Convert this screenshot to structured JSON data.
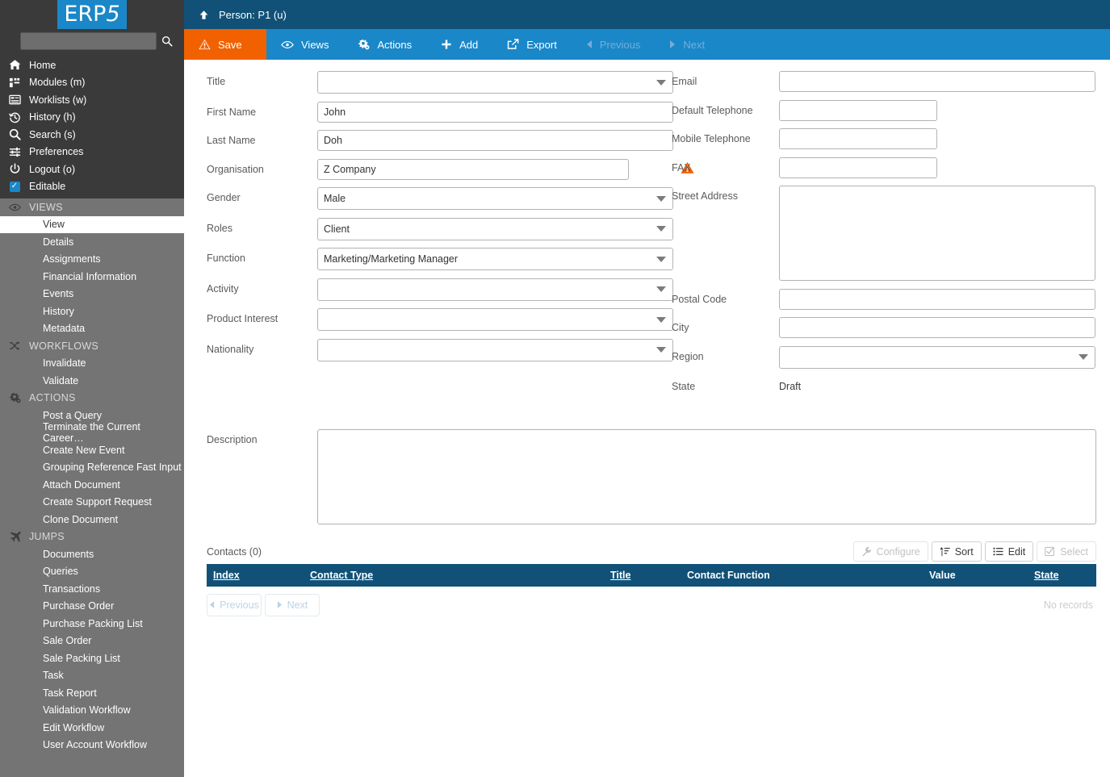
{
  "brand": {
    "name": "ERP5",
    "name_main": "ERP",
    "name_accent": "5"
  },
  "sidebar": {
    "search": {
      "value": "",
      "placeholder": ""
    },
    "nav": [
      {
        "label": "Home",
        "icon": "home-icon"
      },
      {
        "label": "Modules (m)",
        "icon": "modules-icon"
      },
      {
        "label": "Worklists (w)",
        "icon": "worklists-icon"
      },
      {
        "label": "History (h)",
        "icon": "history-icon"
      },
      {
        "label": "Search (s)",
        "icon": "search-icon"
      },
      {
        "label": "Preferences",
        "icon": "sliders-icon"
      },
      {
        "label": "Logout (o)",
        "icon": "power-icon"
      },
      {
        "label": "Editable",
        "icon": "checkbox-icon"
      }
    ],
    "groups": [
      {
        "title": "VIEWS",
        "icon": "eye-icon",
        "items": [
          {
            "label": "View",
            "active": true
          },
          {
            "label": "Details",
            "active": false
          },
          {
            "label": "Assignments",
            "active": false
          },
          {
            "label": "Financial Information",
            "active": false
          },
          {
            "label": "Events",
            "active": false
          },
          {
            "label": "History",
            "active": false
          },
          {
            "label": "Metadata",
            "active": false
          }
        ]
      },
      {
        "title": "WORKFLOWS",
        "icon": "shuffle-icon",
        "items": [
          {
            "label": "Invalidate",
            "active": false
          },
          {
            "label": "Validate",
            "active": false
          }
        ]
      },
      {
        "title": "ACTIONS",
        "icon": "gears-icon",
        "items": [
          {
            "label": "Post a Query",
            "active": false
          },
          {
            "label": "Terminate the Current Career…",
            "active": false
          },
          {
            "label": "Create New Event",
            "active": false
          },
          {
            "label": "Grouping Reference Fast Input",
            "active": false
          },
          {
            "label": "Attach Document",
            "active": false
          },
          {
            "label": "Create Support Request",
            "active": false
          },
          {
            "label": "Clone Document",
            "active": false
          }
        ]
      },
      {
        "title": "JUMPS",
        "icon": "plane-icon",
        "items": [
          {
            "label": "Documents",
            "active": false
          },
          {
            "label": "Queries",
            "active": false
          },
          {
            "label": "Transactions",
            "active": false
          },
          {
            "label": "Purchase Order",
            "active": false
          },
          {
            "label": "Purchase Packing List",
            "active": false
          },
          {
            "label": "Sale Order",
            "active": false
          },
          {
            "label": "Sale Packing List",
            "active": false
          },
          {
            "label": "Task",
            "active": false
          },
          {
            "label": "Task Report",
            "active": false
          },
          {
            "label": "Validation Workflow",
            "active": false
          },
          {
            "label": "Edit Workflow",
            "active": false
          },
          {
            "label": "User Account Workflow",
            "active": false
          }
        ]
      }
    ]
  },
  "header": {
    "title": "Person: P1 (u)",
    "up_icon": "arrow-up-icon"
  },
  "toolbar": {
    "save": "Save",
    "views": "Views",
    "actions": "Actions",
    "add": "Add",
    "export": "Export",
    "previous": "Previous",
    "next": "Next"
  },
  "form": {
    "left": [
      {
        "label": "Title",
        "type": "select",
        "value": ""
      },
      {
        "label": "First Name",
        "type": "text",
        "value": "John"
      },
      {
        "label": "Last Name",
        "type": "text",
        "value": "Doh"
      },
      {
        "label": "Organisation",
        "type": "text",
        "value": "Z Company",
        "warning": true
      },
      {
        "label": "Gender",
        "type": "select",
        "value": "Male"
      },
      {
        "label": "Roles",
        "type": "select",
        "value": "Client"
      },
      {
        "label": "Function",
        "type": "select",
        "value": "Marketing/Marketing Manager"
      },
      {
        "label": "Activity",
        "type": "select",
        "value": ""
      },
      {
        "label": "Product Interest",
        "type": "select",
        "value": ""
      },
      {
        "label": "Nationality",
        "type": "select",
        "value": ""
      }
    ],
    "right": [
      {
        "label": "Email",
        "type": "text",
        "value": ""
      },
      {
        "label": "Default Telephone",
        "type": "text-narrow",
        "value": ""
      },
      {
        "label": "Mobile Telephone",
        "type": "text-narrow",
        "value": ""
      },
      {
        "label": "FAX",
        "type": "text-narrow",
        "value": ""
      },
      {
        "label": "Street Address",
        "type": "textarea",
        "value": ""
      },
      {
        "label": "Postal Code",
        "type": "text",
        "value": ""
      },
      {
        "label": "City",
        "type": "text",
        "value": ""
      },
      {
        "label": "Region",
        "type": "select",
        "value": ""
      },
      {
        "label": "State",
        "type": "static",
        "value": "Draft"
      }
    ],
    "description": {
      "label": "Description",
      "value": ""
    }
  },
  "contacts": {
    "title": "Contacts (0)",
    "tools": [
      {
        "label": "Configure",
        "icon": "wrench-icon",
        "disabled": true
      },
      {
        "label": "Sort",
        "icon": "sort-icon",
        "disabled": false
      },
      {
        "label": "Edit",
        "icon": "list-icon",
        "disabled": false
      },
      {
        "label": "Select",
        "icon": "check-square-icon",
        "disabled": true
      }
    ],
    "columns": [
      {
        "label": "Index",
        "sortable": true
      },
      {
        "label": "Contact Type",
        "sortable": true
      },
      {
        "label": "Title",
        "sortable": true
      },
      {
        "label": "Contact Function",
        "sortable": false
      },
      {
        "label": "Value",
        "sortable": false
      },
      {
        "label": "State",
        "sortable": true
      }
    ],
    "rows": [],
    "empty_text": "No records",
    "pager": {
      "previous": "Previous",
      "next": "Next"
    }
  },
  "colors": {
    "header_blue": "#115177",
    "toolbar_blue": "#1a87c8",
    "save_orange": "#f26100",
    "sidebar_dark": "#3a3a3a",
    "sidebar_grey": "#747474"
  }
}
